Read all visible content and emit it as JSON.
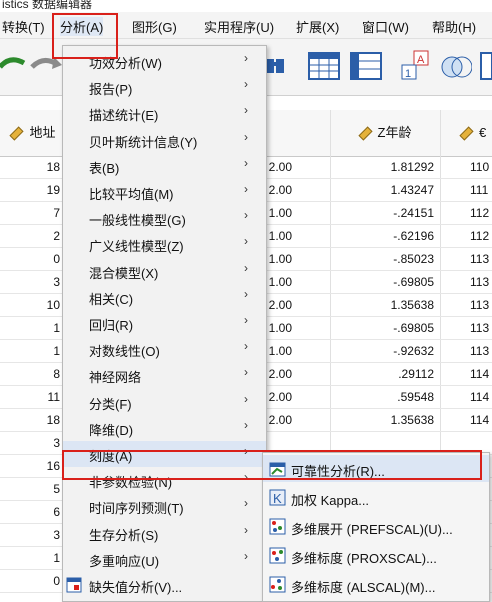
{
  "window": {
    "title": "istics 数据编辑器"
  },
  "menubar": [
    {
      "label": "转换(T)"
    },
    {
      "label": "分析(A)"
    },
    {
      "label": "图形(G)"
    },
    {
      "label": "实用程序(U)"
    },
    {
      "label": "扩展(X)"
    },
    {
      "label": "窗口(W)"
    },
    {
      "label": "帮助(H)"
    }
  ],
  "grid": {
    "headers": {
      "address": "地址",
      "z_age": "Z年龄",
      "last": "€"
    },
    "rows": [
      {
        "address": "18",
        "mid": "2.00",
        "z": "1.81292",
        "last": "110"
      },
      {
        "address": "19",
        "mid": "2.00",
        "z": "1.43247",
        "last": "111"
      },
      {
        "address": "7",
        "mid": "1.00",
        "z": "-.24151",
        "last": "112"
      },
      {
        "address": "2",
        "mid": "1.00",
        "z": "-.62196",
        "last": "112"
      },
      {
        "address": "0",
        "mid": "1.00",
        "z": "-.85023",
        "last": "113"
      },
      {
        "address": "3",
        "mid": "1.00",
        "z": "-.69805",
        "last": "113"
      },
      {
        "address": "10",
        "mid": "2.00",
        "z": "1.35638",
        "last": "113"
      },
      {
        "address": "1",
        "mid": "1.00",
        "z": "-.69805",
        "last": "113"
      },
      {
        "address": "1",
        "mid": "1.00",
        "z": "-.92632",
        "last": "113"
      },
      {
        "address": "8",
        "mid": "2.00",
        "z": ".29112",
        "last": "114"
      },
      {
        "address": "11",
        "mid": "2.00",
        "z": ".59548",
        "last": "114"
      },
      {
        "address": "18",
        "mid": "2.00",
        "z": "1.35638",
        "last": "114"
      },
      {
        "address": "3",
        "mid": "",
        "z": "",
        "last": ""
      },
      {
        "address": "16",
        "mid": "",
        "z": "",
        "last": ""
      },
      {
        "address": "5",
        "mid": "",
        "z": "",
        "last": ""
      },
      {
        "address": "6",
        "mid": "",
        "z": "",
        "last": ""
      },
      {
        "address": "3",
        "mid": "",
        "z": "",
        "last": ""
      },
      {
        "address": "1",
        "mid": "",
        "z": "",
        "last": ""
      },
      {
        "address": "0",
        "mid": "",
        "z": "",
        "last": ""
      }
    ]
  },
  "analyze_menu": {
    "items": [
      {
        "label": "功效分析(W)",
        "arrow": "›"
      },
      {
        "label": "报告(P)",
        "arrow": "›"
      },
      {
        "label": "描述统计(E)",
        "arrow": "›"
      },
      {
        "label": "贝叶斯统计信息(Y)",
        "arrow": "›"
      },
      {
        "label": "表(B)",
        "arrow": "›"
      },
      {
        "label": "比较平均值(M)",
        "arrow": "›"
      },
      {
        "label": "一般线性模型(G)",
        "arrow": "›"
      },
      {
        "label": "广义线性模型(Z)",
        "arrow": "›"
      },
      {
        "label": "混合模型(X)",
        "arrow": "›"
      },
      {
        "label": "相关(C)",
        "arrow": "›"
      },
      {
        "label": "回归(R)",
        "arrow": "›"
      },
      {
        "label": "对数线性(O)",
        "arrow": "›"
      },
      {
        "label": "神经网络",
        "arrow": "›"
      },
      {
        "label": "分类(F)",
        "arrow": "›"
      },
      {
        "label": "降维(D)",
        "arrow": "›"
      },
      {
        "label": "刻度(A)",
        "arrow": "›"
      },
      {
        "label": "非参数检验(N)",
        "arrow": "›"
      },
      {
        "label": "时间序列预测(T)",
        "arrow": "›"
      },
      {
        "label": "生存分析(S)",
        "arrow": "›"
      },
      {
        "label": "多重响应(U)",
        "arrow": "›"
      },
      {
        "label": "缺失值分析(V)...",
        "arrow": ""
      }
    ]
  },
  "scale_submenu": {
    "items": [
      {
        "label": "可靠性分析(R)...",
        "icon": "reliability-icon"
      },
      {
        "label": "加权 Kappa...",
        "icon": "kappa-icon"
      },
      {
        "label": "多维展开 (PREFSCAL)(U)...",
        "icon": "prefscal-icon"
      },
      {
        "label": "多维标度 (PROXSCAL)...",
        "icon": "proxscal-icon"
      },
      {
        "label": "多维标度 (ALSCAL)(M)...",
        "icon": "alscal-icon"
      }
    ]
  },
  "colors": {
    "highlight_red": "#d9201a",
    "menu_hover": "#dce6f4"
  }
}
